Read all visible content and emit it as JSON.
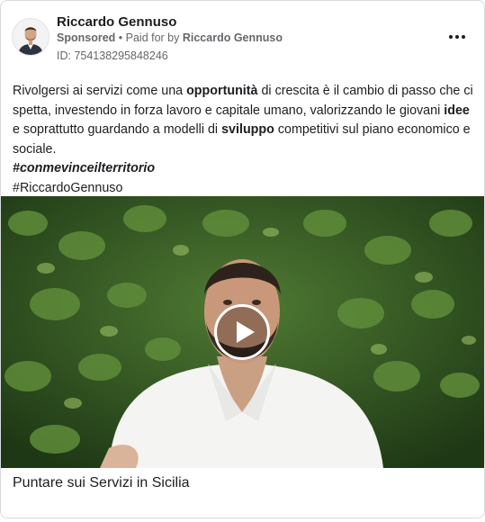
{
  "header": {
    "author": "Riccardo Gennuso",
    "sponsored": "Sponsored",
    "separator": " • ",
    "paid_for_prefix": "Paid for by ",
    "payer": "Riccardo Gennuso",
    "ad_id": "ID: 754138295848246",
    "more_icon": "more-horizontal-icon"
  },
  "post": {
    "t1": "Rivolgersi ai servizi come una ",
    "b1": "opportunità",
    "t2": " di crescita è il cambio di passo che ci spetta, investendo in forza lavoro e capitale umano, valorizzando le giovani ",
    "b2": "idee",
    "t3": " e soprattutto guardando a modelli di ",
    "b3": "sviluppo",
    "t4": " competitivi sul piano economico e sociale.",
    "hashtag1": "#conmevinceilterritorio",
    "hashtag2": "#RiccardoGennuso"
  },
  "media": {
    "type": "video",
    "play_icon": "play-icon",
    "title": "Puntare sui Servizi in Sicilia"
  },
  "colors": {
    "text": "#1c1e21",
    "secondary": "#65676b",
    "border": "#d9dbdf",
    "foliage": "#2f5a1f"
  }
}
